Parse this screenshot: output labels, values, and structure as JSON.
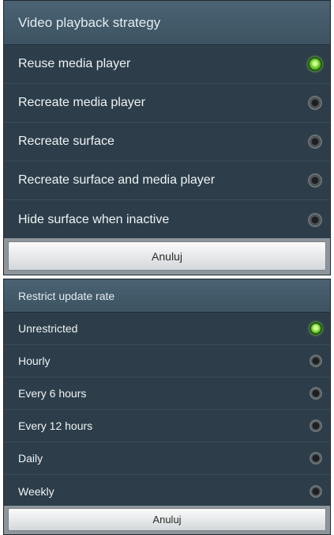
{
  "dialogs": [
    {
      "title": "Video playback strategy",
      "options": [
        {
          "label": "Reuse media player",
          "selected": true
        },
        {
          "label": "Recreate media player",
          "selected": false
        },
        {
          "label": "Recreate surface",
          "selected": false
        },
        {
          "label": "Recreate surface and media player",
          "selected": false
        },
        {
          "label": "Hide surface when inactive",
          "selected": false
        }
      ],
      "cancel_label": "Anuluj"
    },
    {
      "title": "Restrict update rate",
      "options": [
        {
          "label": "Unrestricted",
          "selected": true
        },
        {
          "label": "Hourly",
          "selected": false
        },
        {
          "label": "Every 6 hours",
          "selected": false
        },
        {
          "label": "Every 12 hours",
          "selected": false
        },
        {
          "label": "Daily",
          "selected": false
        },
        {
          "label": "Weekly",
          "selected": false
        }
      ],
      "cancel_label": "Anuluj"
    }
  ],
  "colors": {
    "dialog_background": "#2d3e4a",
    "title_background": "#4a6272",
    "radio_selected": "#6fd12d",
    "radio_unselected": "#2b2e30"
  }
}
